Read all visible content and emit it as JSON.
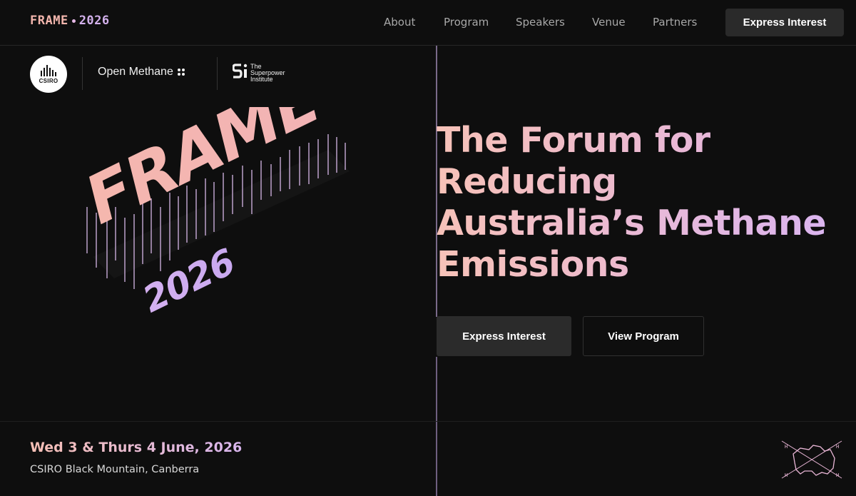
{
  "header": {
    "brand_primary": "FRAME",
    "brand_secondary": "2026",
    "nav": [
      "About",
      "Program",
      "Speakers",
      "Venue",
      "Partners"
    ],
    "cta_label": "Express Interest"
  },
  "partners": {
    "csiro_label": "CSIRO",
    "open_methane_label": "Open Methane",
    "superpower_line1": "The",
    "superpower_line2": "Superpower",
    "superpower_line3": "Institute"
  },
  "logo_art": {
    "word": "FRAME",
    "year": "2026"
  },
  "hero": {
    "line1": "The Forum for",
    "line2": "Reducing",
    "line3": "Australia’s Methane",
    "line4": "Emissions",
    "primary_button": "Express Interest",
    "secondary_button": "View Program"
  },
  "event": {
    "date": "Wed 3 & Thurs 4 June, 2026",
    "venue": "CSIRO Black Mountain, Canberra"
  },
  "colors": {
    "background": "#0e0e0e",
    "accent_peach": "#f7c2b8",
    "accent_lavender": "#d7b5ee",
    "button_dark": "#2b2b2b"
  },
  "icons": {
    "map": "australia-map-icon"
  }
}
